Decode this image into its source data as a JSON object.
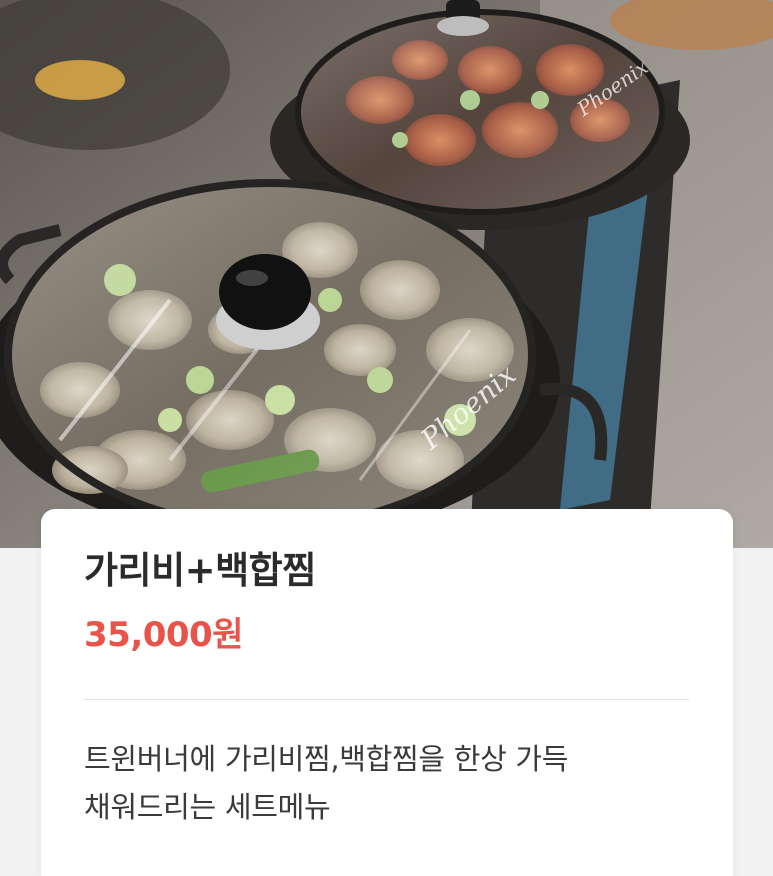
{
  "hero": {
    "lid_brand_text": "Phoenix"
  },
  "product": {
    "title": "가리비+백합찜",
    "price": "35,000원",
    "description_lines": [
      "트윈버너에 가리비찜,백합찜을 한상 가득",
      "채워드리는 세트메뉴"
    ]
  },
  "colors": {
    "price": "#e8534a",
    "title": "#2b2b2b",
    "background": "#f2f2f2"
  }
}
